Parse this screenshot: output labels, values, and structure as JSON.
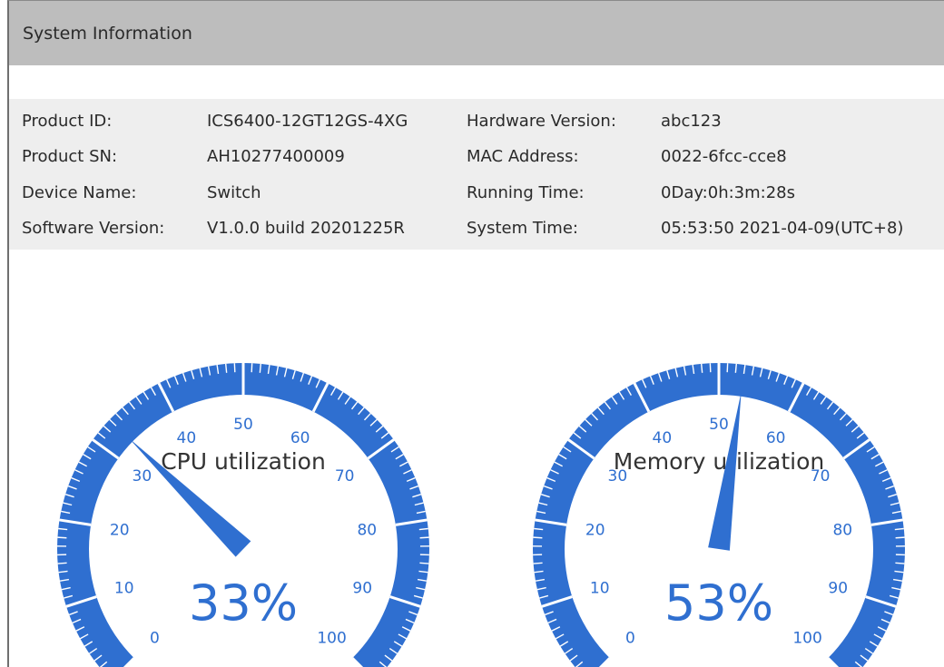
{
  "panel": {
    "title": "System Information"
  },
  "info": {
    "rows": [
      {
        "left_label": "Product ID:",
        "left_value": "ICS6400-12GT12GS-4XG",
        "right_label": "Hardware Version:",
        "right_value": "abc123"
      },
      {
        "left_label": "Product SN:",
        "left_value": "AH10277400009",
        "right_label": "MAC Address:",
        "right_value": "0022-6fcc-cce8"
      },
      {
        "left_label": "Device Name:",
        "left_value": "Switch",
        "right_label": "Running Time:",
        "right_value": "0Day:0h:3m:28s"
      },
      {
        "left_label": "Software Version:",
        "left_value": "V1.0.0 build 20201225R",
        "right_label": "System Time:",
        "right_value": "05:53:50 2021-04-09(UTC+8)"
      }
    ]
  },
  "gauges": [
    {
      "title": "CPU utilization",
      "value": 33,
      "value_text": "33%"
    },
    {
      "title": "Memory utilization",
      "value": 53,
      "value_text": "53%"
    }
  ],
  "gauge_scale": {
    "min": 0,
    "max": 100,
    "tick_labels": [
      "0",
      "10",
      "20",
      "30",
      "40",
      "50",
      "60",
      "70",
      "80",
      "90",
      "100"
    ]
  },
  "colors": {
    "gauge": "#2f6fd0",
    "tick_text": "#2f6fd0",
    "title_text": "#333333"
  }
}
